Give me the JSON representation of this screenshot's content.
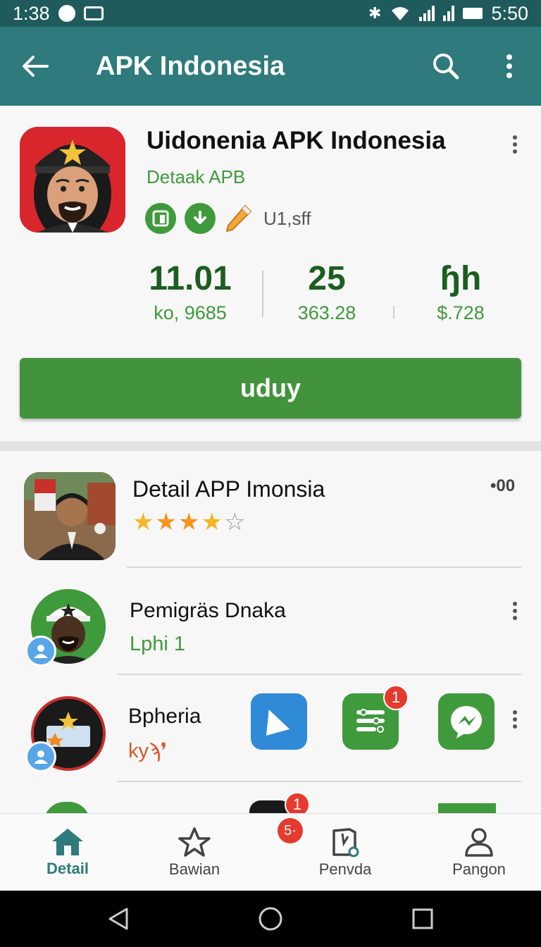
{
  "status_bar": {
    "time_left": "1:38",
    "time_right": "5:50"
  },
  "app_bar": {
    "title": "APK Indonesia"
  },
  "header": {
    "app_name": "Uidonenia APK Indonesia",
    "app_subtitle": "Detaak APB",
    "badge_text": "U1,sff",
    "stats": [
      {
        "value": "11.01",
        "label": "ko, 9685"
      },
      {
        "value": "25",
        "label": "363.28"
      },
      {
        "value": "ɧh",
        "label": "$.728"
      }
    ],
    "install_label": "uduy"
  },
  "list": {
    "items": [
      {
        "name": "Detail APP Imonsia",
        "rating": 4,
        "extra": "•00"
      },
      {
        "name": "Pemigräs Dnaka",
        "meta": "Lphi 1"
      },
      {
        "name": "Bpheria",
        "meta": "kyϡ❜"
      }
    ],
    "notification_count": "1",
    "partial_notification": "1"
  },
  "bottom_nav": {
    "items": [
      {
        "label": "Detail",
        "icon": "home-icon"
      },
      {
        "label": "Bawian",
        "icon": "star-icon"
      },
      {
        "label": "Penvda",
        "icon": "bookmark-icon"
      },
      {
        "label": "Pangon",
        "icon": "person-icon"
      }
    ],
    "badge": "5·"
  },
  "colors": {
    "app_bar": "#2e7a7c",
    "status_bar": "#1f5b5c",
    "accent_green": "#43933c",
    "stat_green": "#1b5e20",
    "notif_red": "#e63a2e"
  }
}
